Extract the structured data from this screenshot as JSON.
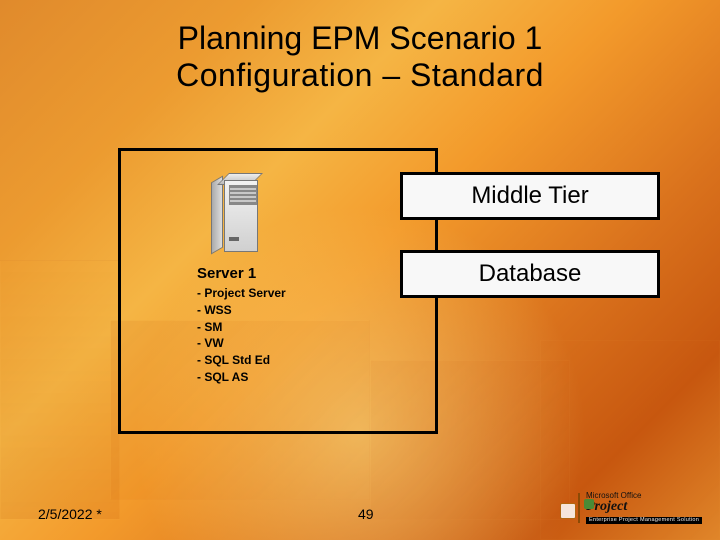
{
  "title": {
    "line1": "Planning EPM Scenario 1",
    "line2": "Configuration – Standard"
  },
  "server": {
    "label": "Server 1",
    "components": [
      "- Project Server",
      "- WSS",
      "- SM",
      "- VW",
      "- SQL Std Ed",
      "- SQL AS"
    ]
  },
  "tiers": {
    "middle": "Middle Tier",
    "database": "Database"
  },
  "footer": {
    "date": "2/5/2022 *",
    "page": "49"
  },
  "logo": {
    "brand_small": "Microsoft Office",
    "product": "Project",
    "tagline": "Enterprise Project Management Solution"
  }
}
